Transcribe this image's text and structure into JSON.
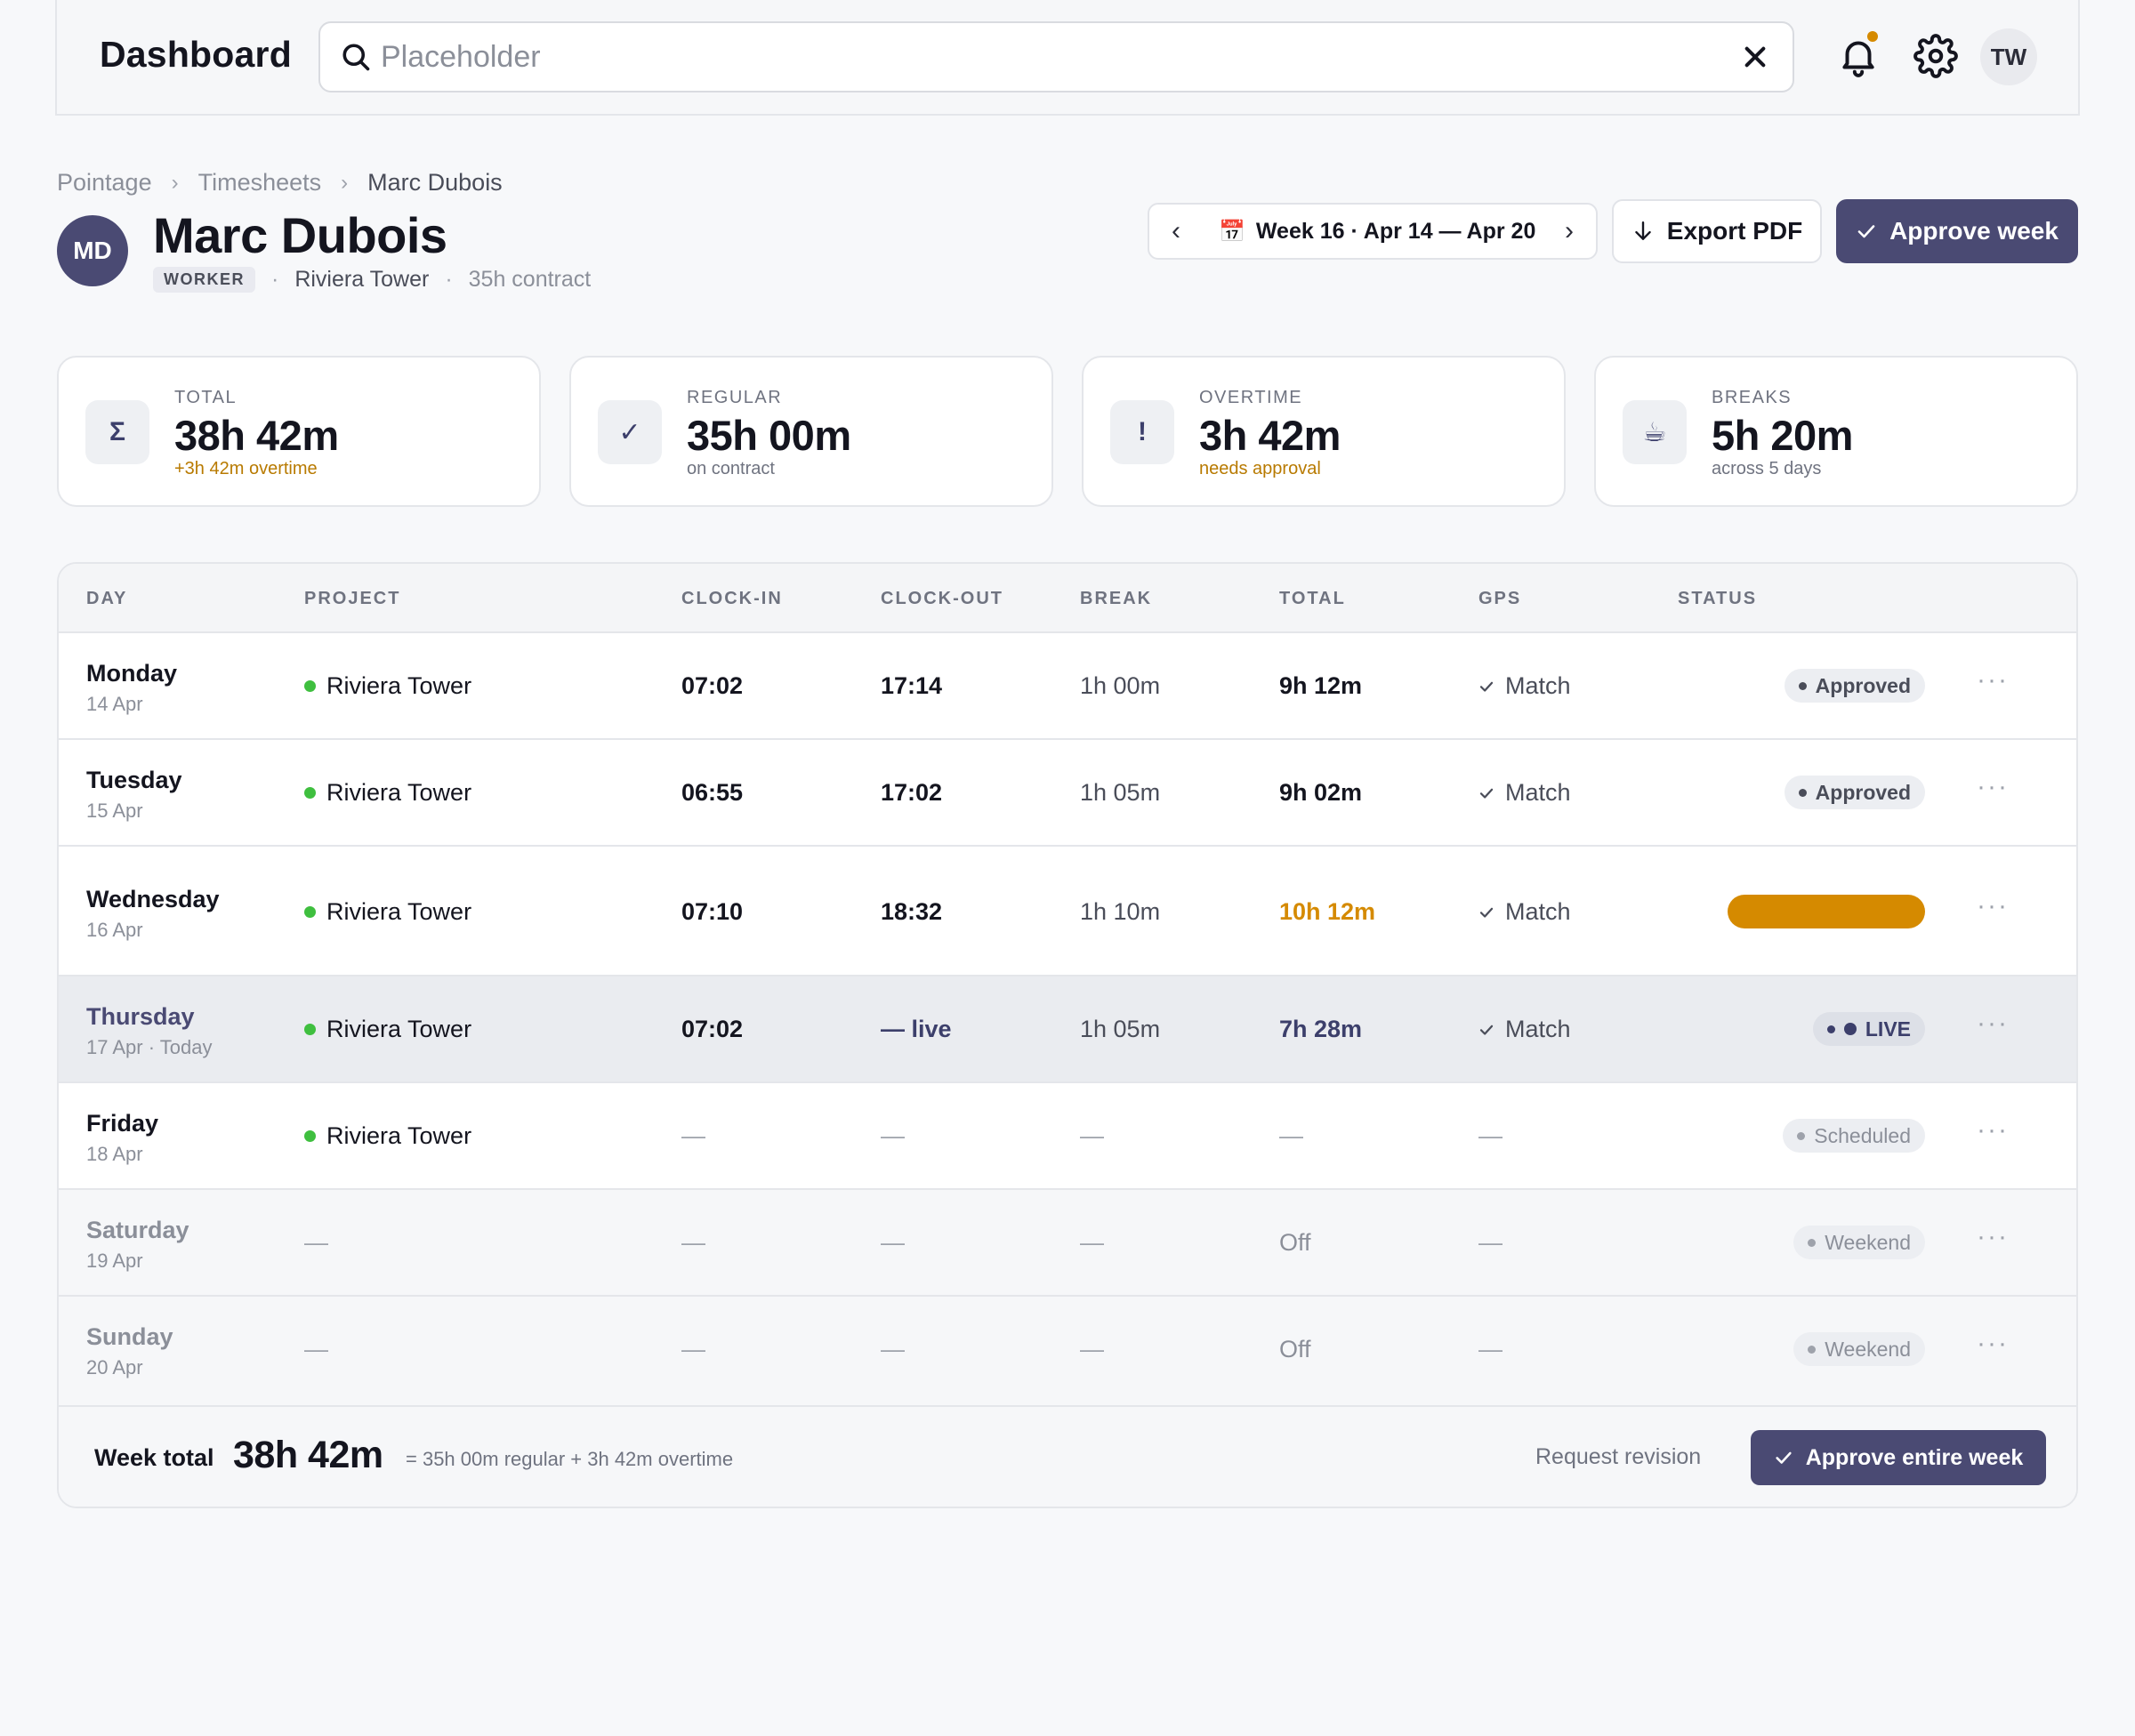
{
  "app": {
    "title": "Dashboard"
  },
  "search": {
    "placeholder": "Placeholder",
    "value": ""
  },
  "user": {
    "initials": "TW"
  },
  "colors": {
    "accent": "#4a4a73",
    "warning": "#d58a00",
    "project_dot": "#3fbf3f"
  },
  "breadcrumb": [
    "Pointage",
    "Timesheets",
    "Marc Dubois"
  ],
  "employee": {
    "initials": "MD",
    "name": "Marc Dubois",
    "role": "WORKER",
    "site": "Riviera Tower",
    "contract": "35h contract"
  },
  "week": {
    "label": "Week 16 · Apr 14 — Apr 20",
    "prev_glyph": "‹",
    "next_glyph": "›",
    "calendar_glyph": "📅"
  },
  "actions": {
    "export_label": "Export PDF",
    "approve_label": "Approve week"
  },
  "stats": [
    {
      "icon": "sigma-icon",
      "glyph": "Σ",
      "label": "TOTAL",
      "value": "38h 42m",
      "sub": "+3h 42m overtime",
      "sub_tone": "warn"
    },
    {
      "icon": "check-icon",
      "glyph": "✓",
      "label": "REGULAR",
      "value": "35h 00m",
      "sub": "on contract",
      "sub_tone": "muted"
    },
    {
      "icon": "exclamation-icon",
      "glyph": "!",
      "label": "OVERTIME",
      "value": "3h 42m",
      "sub": "needs approval",
      "sub_tone": "warn"
    },
    {
      "icon": "coffee-icon",
      "glyph": "☕",
      "label": "BREAKS",
      "value": "5h 20m",
      "sub": "across 5 days",
      "sub_tone": "muted"
    }
  ],
  "table": {
    "columns": [
      "DAY",
      "PROJECT",
      "CLOCK-IN",
      "CLOCK-OUT",
      "BREAK",
      "TOTAL",
      "GPS",
      "STATUS"
    ],
    "rows": [
      {
        "day": "Monday",
        "date": "14 Apr",
        "project": "Riviera Tower",
        "clock_in": "07:02",
        "clock_out": "17:14",
        "break": "1h 00m",
        "total": "9h 12m",
        "gps": "Match",
        "status": "Approved",
        "kind": "approved"
      },
      {
        "day": "Tuesday",
        "date": "15 Apr",
        "project": "Riviera Tower",
        "clock_in": "06:55",
        "clock_out": "17:02",
        "break": "1h 05m",
        "total": "9h 02m",
        "gps": "Match",
        "status": "Approved",
        "kind": "approved"
      },
      {
        "day": "Wednesday",
        "date": "16 Apr",
        "project": "Riviera Tower",
        "clock_in": "07:10",
        "clock_out": "18:32",
        "break": "1h 10m",
        "total": "10h 12m",
        "gps": "Match",
        "status": "",
        "kind": "overtime"
      },
      {
        "day": "Thursday",
        "date": "17 Apr · Today",
        "project": "Riviera Tower",
        "clock_in": "07:02",
        "clock_out": "— live",
        "break": "1h 05m",
        "total": "7h 28m",
        "gps": "Match",
        "status": "LIVE",
        "kind": "live"
      },
      {
        "day": "Friday",
        "date": "18 Apr",
        "project": "Riviera Tower",
        "clock_in": "—",
        "clock_out": "—",
        "break": "—",
        "total": "—",
        "gps": "—",
        "status": "Scheduled",
        "kind": "scheduled"
      },
      {
        "day": "Saturday",
        "date": "19 Apr",
        "project": "—",
        "clock_in": "—",
        "clock_out": "—",
        "break": "—",
        "total": "Off",
        "gps": "—",
        "status": "Weekend",
        "kind": "weekend"
      },
      {
        "day": "Sunday",
        "date": "20 Apr",
        "project": "—",
        "clock_in": "—",
        "clock_out": "—",
        "break": "—",
        "total": "Off",
        "gps": "—",
        "status": "Weekend",
        "kind": "weekend"
      }
    ]
  },
  "footer": {
    "week_total_label": "Week total",
    "week_total_value": "38h 42m",
    "breakdown": "= 35h 00m regular + 3h 42m overtime",
    "revision_label": "Request revision",
    "approve_label": "Approve entire week"
  }
}
